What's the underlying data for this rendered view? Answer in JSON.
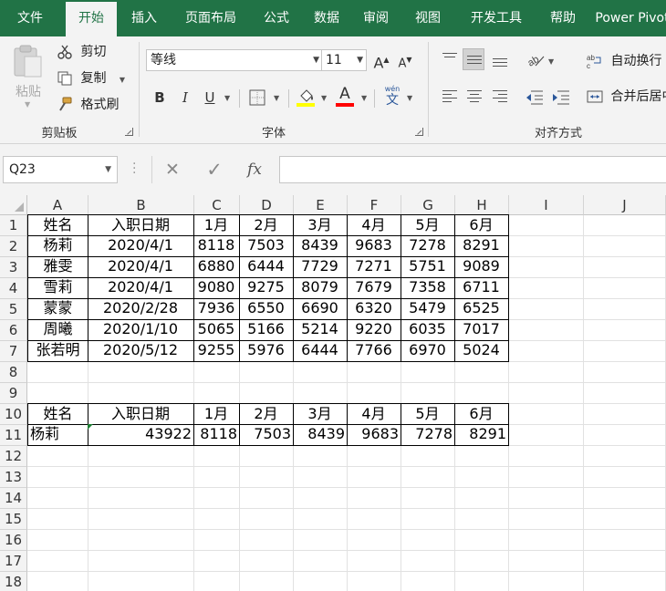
{
  "tabs": [
    "文件",
    "开始",
    "插入",
    "页面布局",
    "公式",
    "数据",
    "审阅",
    "视图",
    "开发工具",
    "帮助",
    "Power Pivot"
  ],
  "active_tab": "开始",
  "clipboard": {
    "paste_label": "粘贴",
    "cut_label": "剪切",
    "copy_label": "复制",
    "format_painter_label": "格式刷",
    "group_label": "剪贴板"
  },
  "font": {
    "font_name": "等线",
    "font_size": "11",
    "grow_label": "A",
    "shrink_label": "A",
    "bold": "B",
    "italic": "I",
    "underline": "U",
    "font_color_glyph": "A",
    "phonetic_top": "wén",
    "phonetic_bottom": "文",
    "group_label": "字体",
    "highlight_color": "#ffff00",
    "font_color": "#ff0000"
  },
  "alignment": {
    "wrap_text_label": "自动换行",
    "merge_center_label": "合并后居中",
    "group_label": "对齐方式"
  },
  "formula_bar": {
    "name_box": "Q23",
    "cancel_glyph": "✕",
    "enter_glyph": "✓",
    "fx_glyph": "fx",
    "formula": ""
  },
  "sheet": {
    "columns": [
      "A",
      "B",
      "C",
      "D",
      "E",
      "F",
      "G",
      "H",
      "I",
      "J"
    ],
    "rows": [
      "1",
      "2",
      "3",
      "4",
      "5",
      "6",
      "7",
      "8",
      "9",
      "10",
      "11",
      "12",
      "13",
      "14",
      "15",
      "16",
      "17",
      "18"
    ],
    "table1": {
      "header": [
        "姓名",
        "入职日期",
        "1月",
        "2月",
        "3月",
        "4月",
        "5月",
        "6月"
      ],
      "rows": [
        [
          "杨莉",
          "2020/4/1",
          "8118",
          "7503",
          "8439",
          "9683",
          "7278",
          "8291"
        ],
        [
          "雅雯",
          "2020/4/1",
          "6880",
          "6444",
          "7729",
          "7271",
          "5751",
          "9089"
        ],
        [
          "雪莉",
          "2020/4/1",
          "9080",
          "9275",
          "8079",
          "7679",
          "7358",
          "6711"
        ],
        [
          "蒙蒙",
          "2020/2/28",
          "7936",
          "6550",
          "6690",
          "6320",
          "5479",
          "6525"
        ],
        [
          "周曦",
          "2020/1/10",
          "5065",
          "5166",
          "5214",
          "9220",
          "6035",
          "7017"
        ],
        [
          "张若明",
          "2020/5/12",
          "9255",
          "5976",
          "6444",
          "7766",
          "6970",
          "5024"
        ]
      ]
    },
    "table2": {
      "header": [
        "姓名",
        "入职日期",
        "1月",
        "2月",
        "3月",
        "4月",
        "5月",
        "6月"
      ],
      "row": [
        "杨莉",
        "43922",
        "8118",
        "7503",
        "8439",
        "9683",
        "7278",
        "8291"
      ]
    }
  }
}
